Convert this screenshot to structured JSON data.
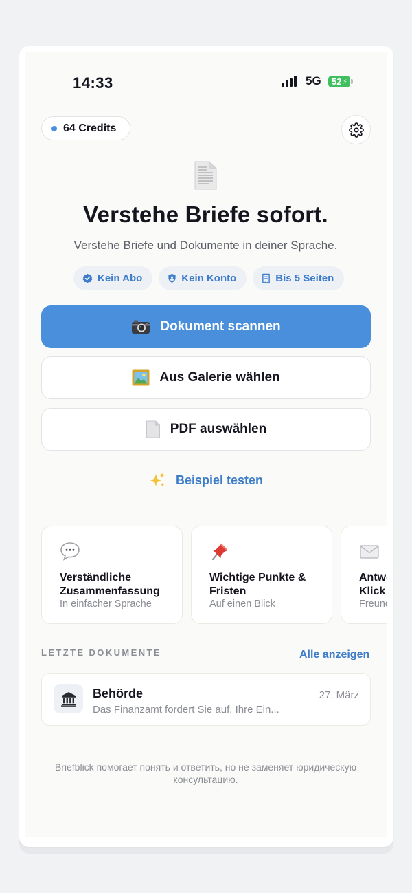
{
  "status_bar": {
    "time": "14:33",
    "network": "5G",
    "battery": "52"
  },
  "header": {
    "credits_label": "64 Credits"
  },
  "hero": {
    "title": "Verstehe Briefe sofort.",
    "subtitle": "Verstehe Briefe und Dokumente in deiner Sprache."
  },
  "chips": [
    {
      "label": "Kein Abo"
    },
    {
      "label": "Kein Konto"
    },
    {
      "label": "Bis 5 Seiten"
    }
  ],
  "actions": {
    "scan_label": "Dokument scannen",
    "gallery_label": "Aus Galerie wählen",
    "pdf_label": "PDF auswählen",
    "example_label": "Beispiel testen"
  },
  "features": [
    {
      "title": "Verständliche Zusammenfassung",
      "subtitle": "In einfacher Sprache"
    },
    {
      "title": "Wichtige Punkte & Fristen",
      "subtitle": "Auf einen Blick"
    },
    {
      "title": "Antwort mit einem Klick",
      "subtitle": "Freundlich formuliert"
    }
  ],
  "recent": {
    "section_label": "LETZTE DOKUMENTE",
    "see_all_label": "Alle anzeigen",
    "items": [
      {
        "title": "Behörde",
        "date": "27. März",
        "snippet": "Das Finanzamt fordert Sie auf, Ihre Ein..."
      }
    ]
  },
  "disclaimer": "Briefblick помогает понять и ответить, но не заменяет юридическую консультацию.",
  "colors": {
    "accent": "#4a8fdb",
    "battery_green": "#3fbf5f",
    "chip_bg": "#edf1f6"
  }
}
